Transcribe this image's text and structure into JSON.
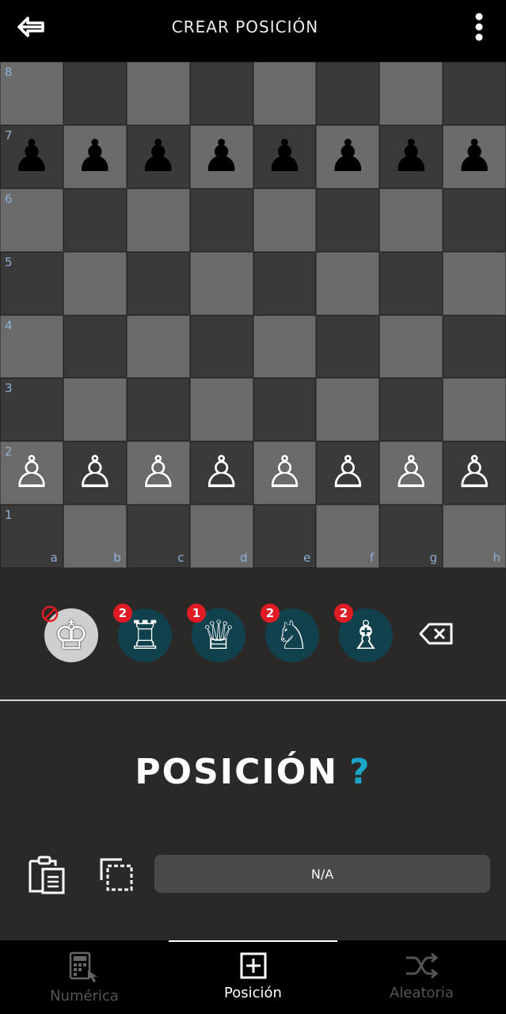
{
  "header": {
    "title": "CREAR POSICIÓN",
    "back_icon": "arrow-left-icon",
    "menu_icon": "more-vertical-icon"
  },
  "board": {
    "ranks": [
      "8",
      "7",
      "6",
      "5",
      "4",
      "3",
      "2",
      "1"
    ],
    "files": [
      "a",
      "b",
      "c",
      "d",
      "e",
      "f",
      "g",
      "h"
    ],
    "pieces": {
      "7": [
        "black-pawn",
        "black-pawn",
        "black-pawn",
        "black-pawn",
        "black-pawn",
        "black-pawn",
        "black-pawn",
        "black-pawn"
      ],
      "2": [
        "white-pawn",
        "white-pawn",
        "white-pawn",
        "white-pawn",
        "white-pawn",
        "white-pawn",
        "white-pawn",
        "white-pawn"
      ]
    },
    "colors": {
      "light": "#6b6b6b",
      "dark": "#3a3a3a",
      "label": "#8fb0d4"
    }
  },
  "palette": {
    "pieces": [
      {
        "piece": "king",
        "icon": "white-king-icon",
        "badge": "",
        "forbidden": true
      },
      {
        "piece": "rook",
        "icon": "white-rook-icon",
        "badge": "2",
        "forbidden": false
      },
      {
        "piece": "queen",
        "icon": "white-queen-icon",
        "badge": "1",
        "forbidden": false
      },
      {
        "piece": "knight",
        "icon": "white-knight-icon",
        "badge": "2",
        "forbidden": false
      },
      {
        "piece": "bishop",
        "icon": "white-bishop-icon",
        "badge": "2",
        "forbidden": false
      }
    ],
    "erase_icon": "backspace-icon"
  },
  "position": {
    "title": "POSICIÓN",
    "status": "?",
    "fen_value": "N/A",
    "accent": "#1aa4c8"
  },
  "nav": {
    "items": [
      {
        "label": "Numérica",
        "icon": "calculator-icon",
        "active": false
      },
      {
        "label": "Posición",
        "icon": "plus-square-icon",
        "active": true
      },
      {
        "label": "Aleatoria",
        "icon": "shuffle-icon",
        "active": false
      }
    ]
  }
}
